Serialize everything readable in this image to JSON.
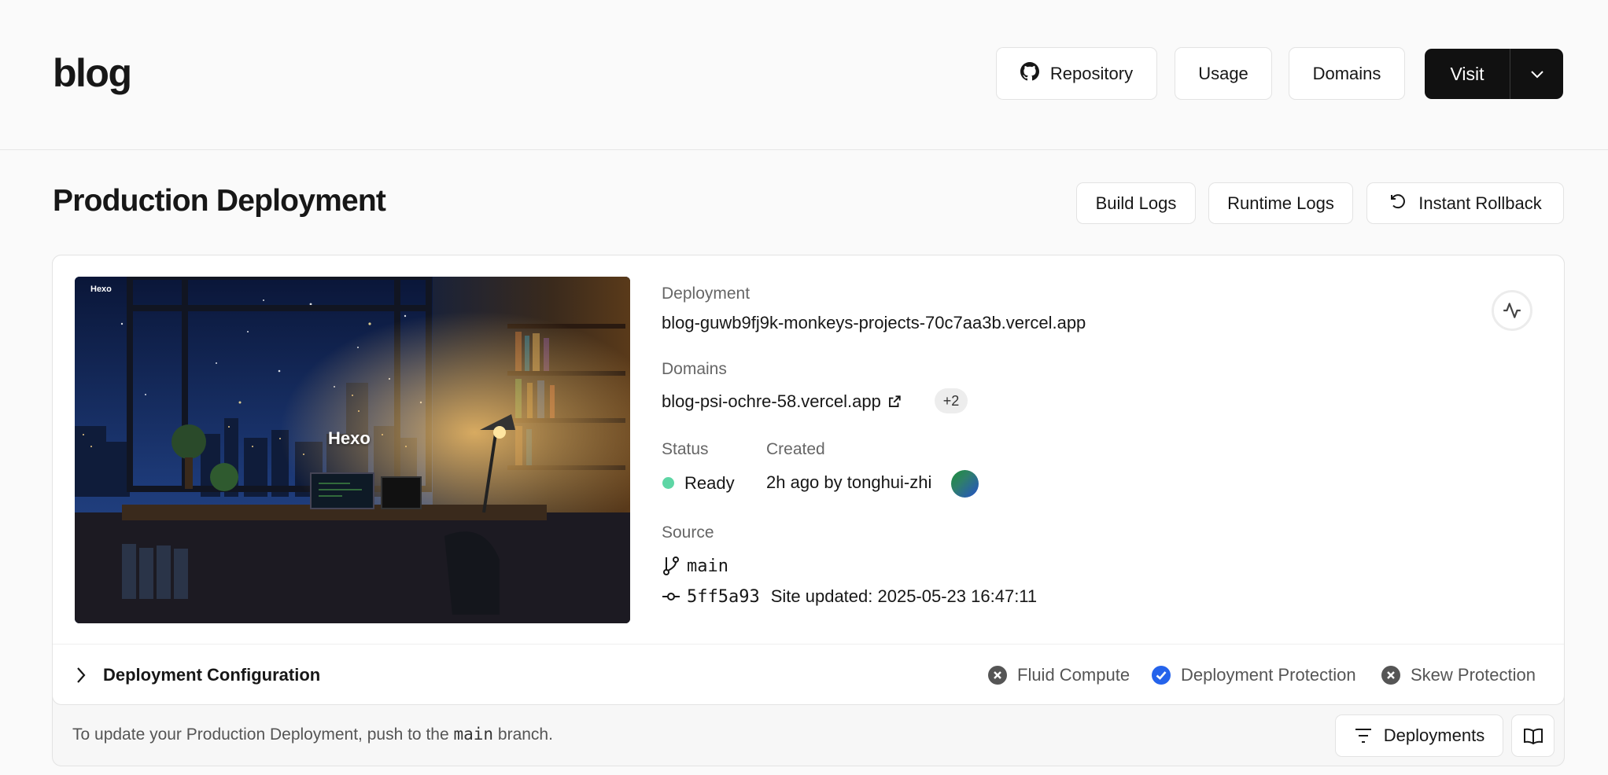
{
  "header": {
    "project_title": "blog",
    "repository_label": "Repository",
    "usage_label": "Usage",
    "domains_label": "Domains",
    "visit_label": "Visit"
  },
  "section": {
    "title": "Production Deployment",
    "build_logs_label": "Build Logs",
    "runtime_logs_label": "Runtime Logs",
    "instant_rollback_label": "Instant Rollback"
  },
  "preview": {
    "corner_text": "Hexo",
    "center_text": "Hexo"
  },
  "deployment": {
    "deployment_label": "Deployment",
    "deployment_url": "blog-guwb9fj9k-monkeys-projects-70c7aa3b.vercel.app",
    "domains_label": "Domains",
    "domain": "blog-psi-ochre-58.vercel.app",
    "extra_domains": "+2",
    "status_label": "Status",
    "status_value": "Ready",
    "created_label": "Created",
    "created_value": "2h ago by tonghui-zhi",
    "source_label": "Source",
    "branch": "main",
    "commit_hash": "5ff5a93",
    "commit_message": "Site updated: 2025-05-23 16:47:11"
  },
  "config": {
    "title": "Deployment Configuration",
    "features": [
      {
        "label": "Fluid Compute",
        "enabled": false
      },
      {
        "label": "Deployment Protection",
        "enabled": true
      },
      {
        "label": "Skew Protection",
        "enabled": false
      }
    ]
  },
  "footer": {
    "text_before": "To update your Production Deployment, push to the",
    "branch": "main",
    "text_after": "branch.",
    "deployments_label": "Deployments"
  },
  "colors": {
    "ready": "#5ed6a5",
    "enabled_blue": "#2563eb",
    "disabled_gray": "#555555",
    "visit_bg": "#111111"
  }
}
